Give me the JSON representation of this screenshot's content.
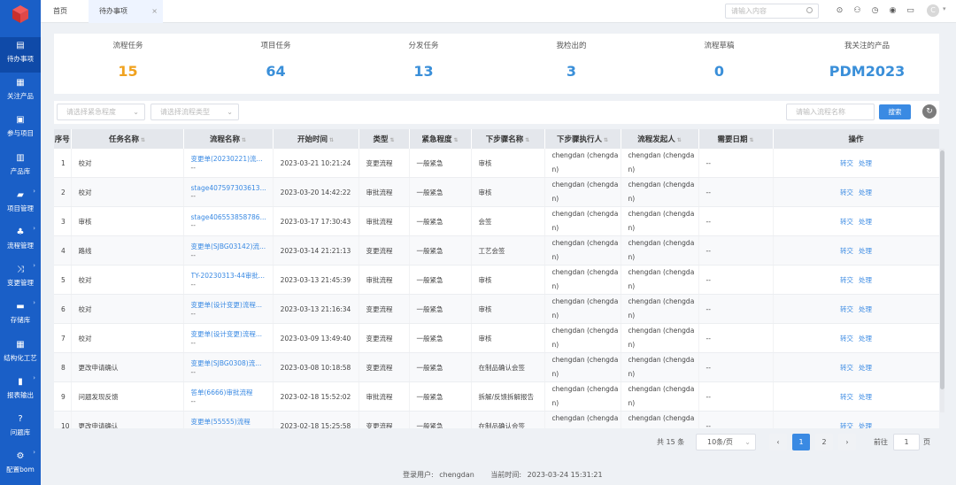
{
  "sidebar": {
    "items": [
      {
        "label": "待办事项",
        "icon": "document-icon",
        "active": true,
        "arrow": false
      },
      {
        "label": "关注产品",
        "icon": "grid-icon",
        "active": false,
        "arrow": false
      },
      {
        "label": "参与项目",
        "icon": "briefcase-icon",
        "active": false,
        "arrow": false
      },
      {
        "label": "产品库",
        "icon": "archive-icon",
        "active": false,
        "arrow": false
      },
      {
        "label": "项目管理",
        "icon": "folder-icon",
        "active": false,
        "arrow": true
      },
      {
        "label": "流程管理",
        "icon": "flowchart-icon",
        "active": false,
        "arrow": true
      },
      {
        "label": "变更管理",
        "icon": "shuffle-icon",
        "active": false,
        "arrow": true
      },
      {
        "label": "存储库",
        "icon": "storage-icon",
        "active": false,
        "arrow": true
      },
      {
        "label": "结构化工艺",
        "icon": "structure-icon",
        "active": false,
        "arrow": false
      },
      {
        "label": "报表输出",
        "icon": "chart-icon",
        "active": false,
        "arrow": true
      },
      {
        "label": "问题库",
        "icon": "question-icon",
        "active": false,
        "arrow": false
      },
      {
        "label": "配置bom",
        "icon": "gear-icon",
        "active": false,
        "arrow": true
      }
    ]
  },
  "tabs": {
    "home": "首页",
    "todo": "待办事项",
    "close": "×"
  },
  "search": {
    "placeholder": "请输入内容"
  },
  "user": {
    "avatar_letter": "C"
  },
  "stats": [
    {
      "title": "流程任务",
      "value": "15",
      "color": "#f0a21f"
    },
    {
      "title": "项目任务",
      "value": "64",
      "color": "#3a8fd9"
    },
    {
      "title": "分发任务",
      "value": "13",
      "color": "#3a8fd9"
    },
    {
      "title": "我检出的",
      "value": "3",
      "color": "#3a8fd9"
    },
    {
      "title": "流程草稿",
      "value": "0",
      "color": "#3a8fd9"
    },
    {
      "title": "我关注的产品",
      "value": "PDM2023",
      "color": "#3a8fd9"
    }
  ],
  "filter": {
    "urgency_placeholder": "请选择紧急程度",
    "flowtype_placeholder": "请选择流程类型",
    "flowname_placeholder": "请输入流程名称",
    "search_label": "搜索",
    "refresh_glyph": "↻"
  },
  "table": {
    "headers": [
      "序号",
      "任务名称",
      "流程名称",
      "开始时间",
      "类型",
      "紧急程度",
      "下步骤名称",
      "下步骤执行人",
      "流程发起人",
      "需要日期",
      "操作"
    ],
    "rows": [
      {
        "no": "1",
        "task": "校对",
        "flow": "变更单(20230221)流...",
        "flow2": "--",
        "start": "2023-03-21 10:21:24",
        "type": "变更流程",
        "urgency": "一般紧急",
        "next": "审核",
        "exec": "chengdan (chengdan)",
        "initiator": "chengdan (chengdan)",
        "date": "--",
        "op1": "转交",
        "op2": "处理"
      },
      {
        "no": "2",
        "task": "校对",
        "flow": "stage40759730361​3...",
        "flow2": "--",
        "start": "2023-03-20 14:42:22",
        "type": "审批流程",
        "urgency": "一般紧急",
        "next": "审核",
        "exec": "chengdan (chengdan)",
        "initiator": "chengdan (chengdan)",
        "date": "--",
        "op1": "转交",
        "op2": "处理"
      },
      {
        "no": "3",
        "task": "审核",
        "flow": "stage406553858786...",
        "flow2": "--",
        "start": "2023-03-17 17:30:43",
        "type": "审批流程",
        "urgency": "一般紧急",
        "next": "会签",
        "exec": "chengdan (chengdan)",
        "initiator": "chengdan (chengdan)",
        "date": "--",
        "op1": "转交",
        "op2": "处理"
      },
      {
        "no": "4",
        "task": "路线",
        "flow": "变更单(SJBG03142)流...",
        "flow2": "--",
        "start": "2023-03-14 21:21:13",
        "type": "变更流程",
        "urgency": "一般紧急",
        "next": "工艺会签",
        "exec": "chengdan (chengdan)",
        "initiator": "chengdan (chengdan)",
        "date": "--",
        "op1": "转交",
        "op2": "处理"
      },
      {
        "no": "5",
        "task": "校对",
        "flow": "TY-20230313-44审批...",
        "flow2": "--",
        "start": "2023-03-13 21:45:39",
        "type": "审批流程",
        "urgency": "一般紧急",
        "next": "审核",
        "exec": "chengdan (chengdan)",
        "initiator": "chengdan (chengdan)",
        "date": "--",
        "op1": "转交",
        "op2": "处理"
      },
      {
        "no": "6",
        "task": "校对",
        "flow": "变更单(设计变更)流程...",
        "flow2": "--",
        "start": "2023-03-13 21:16:34",
        "type": "变更流程",
        "urgency": "一般紧急",
        "next": "审核",
        "exec": "chengdan (chengdan)",
        "initiator": "chengdan (chengdan)",
        "date": "--",
        "op1": "转交",
        "op2": "处理"
      },
      {
        "no": "7",
        "task": "校对",
        "flow": "变更单(设计变更)流程...",
        "flow2": "--",
        "start": "2023-03-09 13:49:40",
        "type": "变更流程",
        "urgency": "一般紧急",
        "next": "审核",
        "exec": "chengdan (chengdan)",
        "initiator": "chengdan (chengdan)",
        "date": "--",
        "op1": "转交",
        "op2": "处理"
      },
      {
        "no": "8",
        "task": "更改申请确认",
        "flow": "变更单(SJBG0308)流...",
        "flow2": "--",
        "start": "2023-03-08 10:18:58",
        "type": "变更流程",
        "urgency": "一般紧急",
        "next": "在制品确认会签",
        "exec": "chengdan (chengdan)",
        "initiator": "chengdan (chengdan)",
        "date": "--",
        "op1": "转交",
        "op2": "处理"
      },
      {
        "no": "9",
        "task": "问题发现反馈",
        "flow": "答单(6666)审批流程",
        "flow2": "--",
        "start": "2023-02-18 15:52:02",
        "type": "审批流程",
        "urgency": "一般紧急",
        "next": "拆解/反馈拆解报告",
        "exec": "chengdan (chengdan)",
        "initiator": "chengdan (chengdan)",
        "date": "--",
        "op1": "转交",
        "op2": "处理"
      },
      {
        "no": "10",
        "task": "更改申请确认",
        "flow": "变更单(55555)流程",
        "flow2": "--",
        "start": "2023-02-18 15:25:58",
        "type": "变更流程",
        "urgency": "一般紧急",
        "next": "在制品确认会签",
        "exec": "chengdan (chengdan)",
        "initiator": "chengdan (chengdan)",
        "date": "--",
        "op1": "转交",
        "op2": "处理"
      }
    ]
  },
  "pager": {
    "total": "共 15 条",
    "pagesize": "10条/页",
    "prev": "‹",
    "pages": [
      "1",
      "2"
    ],
    "next": "›",
    "goto_prefix": "前往",
    "goto_value": "1",
    "goto_suffix": "页"
  },
  "footer": {
    "user_label": "登录用户:",
    "user": "chengdan",
    "time_label": "当前时间:",
    "time": "2023-03-24 15:31:21"
  }
}
